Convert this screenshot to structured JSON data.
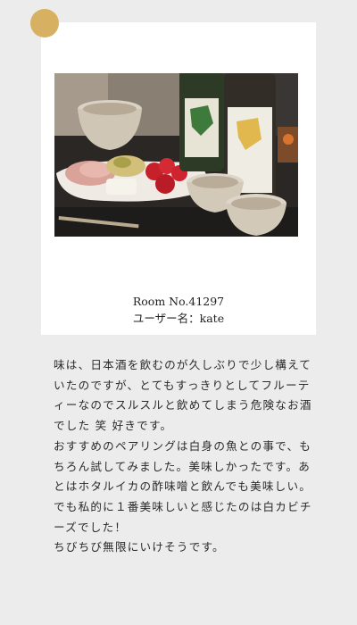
{
  "post": {
    "photo_icon": "food-and-sake-photo",
    "room_label": "Room No.41297",
    "user_label": "ユーザー名：kate"
  },
  "comment": {
    "paragraphs": [
      "味は、日本酒を飲むのが久しぶりで少し構えていたのですが、とてもすっきりとしてフルーティーなのでスルスルと飲めてしまう危険なお酒でした 笑 好きです。",
      "おすすめのペアリングは白身の魚との事で、もちろん試してみました。美味しかったです。あとはホタルイカの酢味噌と飲んでも美味しい。",
      "でも私的に１番美味しいと感じたのは白カビチーズでした！",
      "ちびちび無限にいけそうです。"
    ]
  },
  "colors": {
    "background": "#ececec",
    "card": "#ffffff",
    "accent_dot": "#d8b061"
  }
}
